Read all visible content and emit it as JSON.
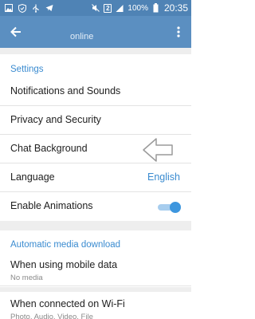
{
  "status_bar": {
    "sim_slot": "2",
    "battery_percent": "100%",
    "time": "20:35"
  },
  "action_bar": {
    "subtitle": "online"
  },
  "settings": {
    "section_title": "Settings",
    "notifications_label": "Notifications and Sounds",
    "privacy_label": "Privacy and Security",
    "chat_background_label": "Chat Background",
    "language_label": "Language",
    "language_value": "English",
    "animations_label": "Enable Animations",
    "animations_enabled": true
  },
  "media_download": {
    "section_title": "Automatic media download",
    "mobile_label": "When using mobile data",
    "mobile_value": "No media",
    "wifi_label": "When connected on Wi-Fi",
    "wifi_value": "Photo, Audio, Video, File"
  },
  "colors": {
    "status_bar": "#4f83b5",
    "action_bar": "#5b8fc1",
    "accent": "#3a8bd0"
  }
}
